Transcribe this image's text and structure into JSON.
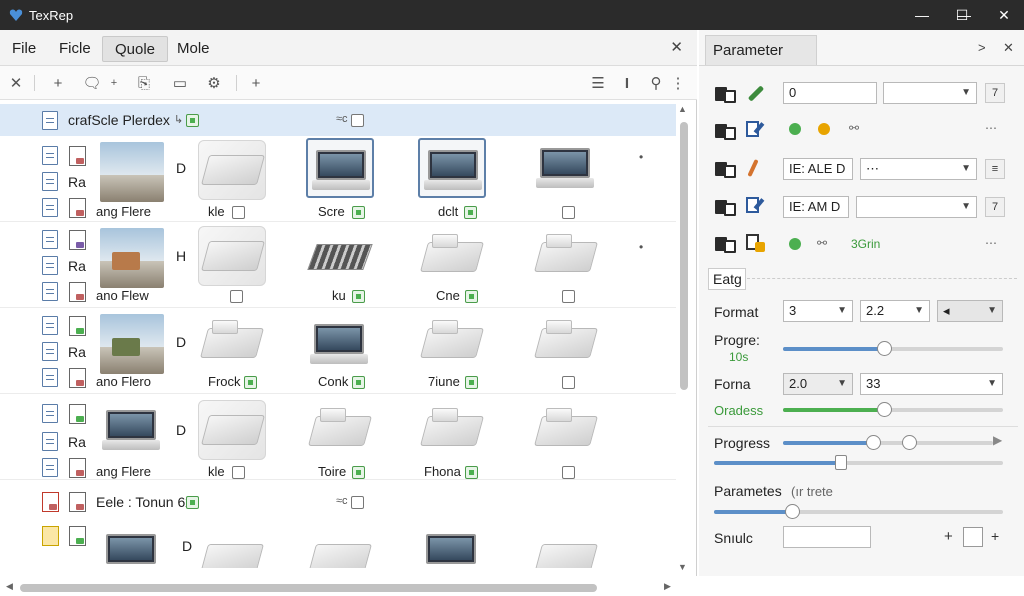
{
  "window": {
    "title": "TexRep",
    "controls": [
      "—",
      "☐",
      "✕"
    ]
  },
  "menu": {
    "items": [
      "File",
      "Ficle",
      "Quole",
      "Mole"
    ],
    "active": 2,
    "close": "✕"
  },
  "toolbar": {
    "buttons": [
      "✕",
      "+",
      "🗨",
      "+",
      "⎘",
      "▭",
      "⚙",
      "+",
      "☰",
      "I",
      "⚲",
      "⋮"
    ]
  },
  "list": {
    "group1": {
      "label": "crafScle Plerdex",
      "tag1": "↳",
      "tag2": "≈c"
    },
    "rows": [
      {
        "letter": "D",
        "ra": "Ra",
        "caption": "ang Flere",
        "cells": [
          "kle",
          "Scre",
          "dclt",
          ""
        ],
        "bullet": "•"
      },
      {
        "letter": "H",
        "ra": "Ra",
        "caption": "ano Flew",
        "cells": [
          "",
          "ku",
          "Cne",
          ""
        ],
        "bullet": "•"
      },
      {
        "letter": "D",
        "ra": "Ra",
        "caption": "ano Flero",
        "cells": [
          "Frock",
          "Conk",
          "7iune",
          ""
        ],
        "bullet": ""
      },
      {
        "letter": "D",
        "ra": "Ra",
        "caption": "ang Flere",
        "cells": [
          "kle",
          "Toire",
          "Fhona",
          ""
        ],
        "bullet": ""
      }
    ],
    "group2": {
      "label": "Eele : Tonun 6x",
      "tag2": "≈c"
    },
    "partial_letter": "D"
  },
  "parameter": {
    "tab": "Parameter",
    "tab_controls": [
      ">",
      "✕"
    ],
    "rows": [
      {
        "field1": "0",
        "field2": "",
        "btn": "7"
      },
      {
        "more": "⋯"
      },
      {
        "field1": "IE: ALE D",
        "field2": "⋯",
        "btn": "≡"
      },
      {
        "field1": "IE: AM D",
        "field2": "",
        "btn": "7"
      },
      {
        "green": "3Grin",
        "more": "⋯"
      }
    ],
    "section": "Eatg",
    "format": {
      "label": "Format",
      "v1": "3",
      "v2": "2.2",
      "v3": "◂"
    },
    "progre": {
      "label": "Progre:",
      "sub": "10s",
      "value": 0.46
    },
    "forma": {
      "label": "Forna",
      "v1": "2.0",
      "v2": "33"
    },
    "oraness": {
      "label": "Oradess",
      "value": 0.46
    },
    "progress": {
      "label": "Progress",
      "value1": 0.43,
      "value2": 0.6,
      "value3": 0.44
    },
    "parametes": {
      "label": "Parametes",
      "note": "(ır trete",
      "value": 0.27
    },
    "snule": {
      "label": "Snıulc",
      "value": "",
      "plus": "+",
      "plus2": "+"
    }
  },
  "colors": {
    "accent": "#5c8fc8",
    "green": "#4caf50",
    "amber": "#e8a400",
    "selected_row": "#dce9f7"
  }
}
